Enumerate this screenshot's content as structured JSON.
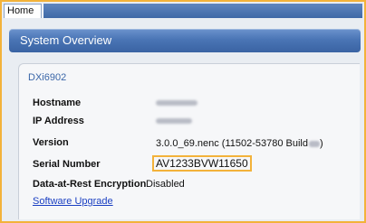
{
  "tabs": [
    {
      "label": "Home",
      "active": true
    }
  ],
  "section": {
    "title": "System Overview"
  },
  "device": {
    "name": "DXi6902"
  },
  "info": {
    "hostname_label": "Hostname",
    "ip_label": "IP Address",
    "version_label": "Version",
    "version_value": "3.0.0_69.nenc (11502-53780 Build",
    "version_suffix": ")",
    "serial_label": "Serial Number",
    "serial_value": "AV1233BVW11650",
    "encryption_label": "Data-at-Rest Encryption",
    "encryption_value": "Disabled"
  },
  "links": {
    "software_upgrade": "Software Upgrade"
  },
  "colors": {
    "highlight": "#f3b23a",
    "header_blue": "#4a75b5",
    "link": "#1a3fc2"
  }
}
